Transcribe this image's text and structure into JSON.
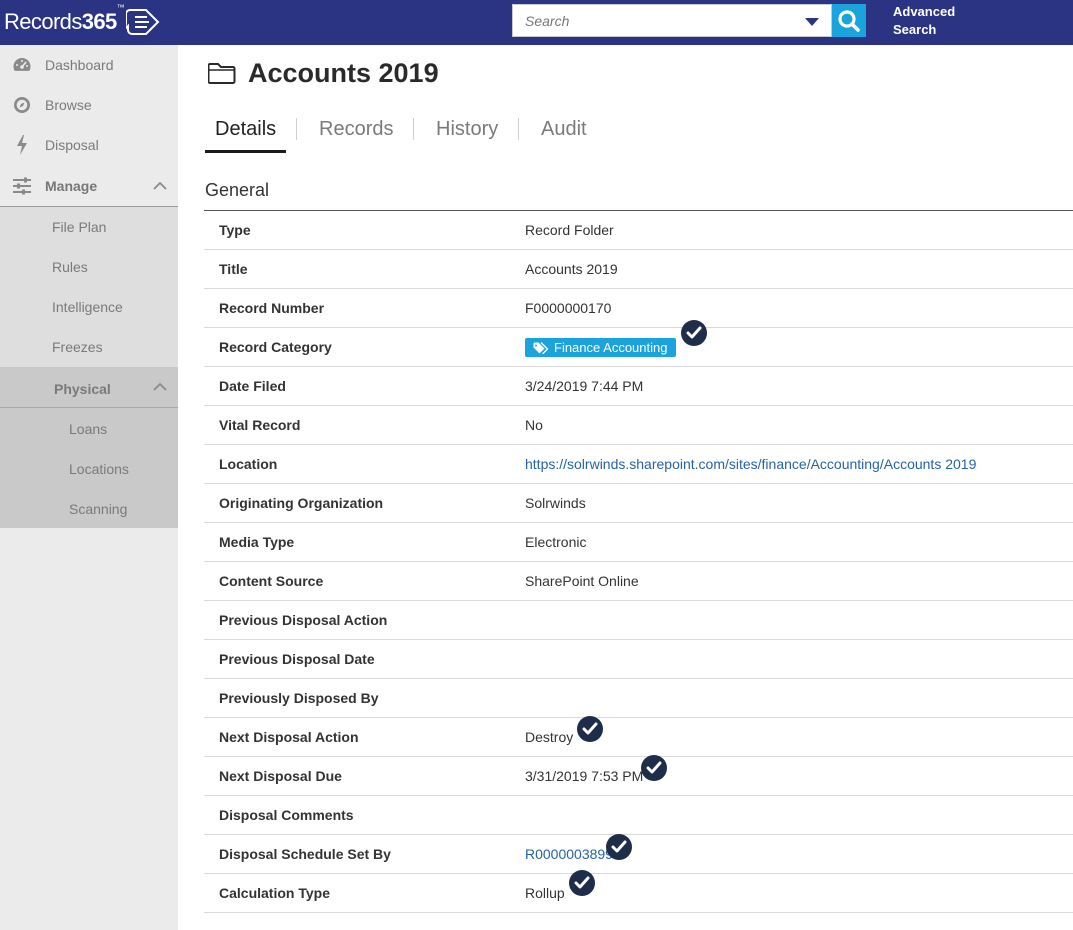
{
  "app": {
    "logo_text_light": "Records",
    "logo_text_bold": "365",
    "logo_tm": "™"
  },
  "search": {
    "placeholder": "Search",
    "advanced_line1": "Advanced",
    "advanced_line2": "Search"
  },
  "sidebar": {
    "items": [
      {
        "label": "Dashboard",
        "icon": "dashboard-gauge-icon"
      },
      {
        "label": "Browse",
        "icon": "compass-icon"
      },
      {
        "label": "Disposal",
        "icon": "lightning-bolt-icon"
      },
      {
        "label": "Manage",
        "icon": "sliders-icon"
      }
    ],
    "manage_items": [
      "File Plan",
      "Rules",
      "Intelligence",
      "Freezes"
    ],
    "physical_label": "Physical",
    "physical_items": [
      "Loans",
      "Locations",
      "Scanning"
    ]
  },
  "page": {
    "title": "Accounts 2019",
    "icon": "folder-icon"
  },
  "tabs": [
    "Details",
    "Records",
    "History",
    "Audit"
  ],
  "active_tab": "Details",
  "section": {
    "title": "General"
  },
  "fields": [
    {
      "key": "Type",
      "value": "Record Folder"
    },
    {
      "key": "Title",
      "value": "Accounts 2019"
    },
    {
      "key": "Record Number",
      "value": "F0000000170"
    },
    {
      "key": "Record Category",
      "value": "Finance Accounting",
      "tag": true,
      "verified": true
    },
    {
      "key": "Date Filed",
      "value": "3/24/2019 7:44 PM"
    },
    {
      "key": "Vital Record",
      "value": "No"
    },
    {
      "key": "Location",
      "value": "https://solrwinds.sharepoint.com/sites/finance/Accounting/Accounts 2019",
      "link": true
    },
    {
      "key": "Originating Organization",
      "value": "Solrwinds"
    },
    {
      "key": "Media Type",
      "value": "Electronic"
    },
    {
      "key": "Content Source",
      "value": "SharePoint Online"
    },
    {
      "key": "Previous Disposal Action",
      "value": ""
    },
    {
      "key": "Previous Disposal Date",
      "value": ""
    },
    {
      "key": "Previously Disposed By",
      "value": ""
    },
    {
      "key": "Next Disposal Action",
      "value": "Destroy",
      "verified": true
    },
    {
      "key": "Next Disposal Due",
      "value": "3/31/2019 7:53 PM",
      "verified": true
    },
    {
      "key": "Disposal Comments",
      "value": ""
    },
    {
      "key": "Disposal Schedule Set By",
      "value": "R0000003899",
      "link": true,
      "verified": true
    },
    {
      "key": "Calculation Type",
      "value": "Rollup",
      "verified": true
    }
  ],
  "colors": {
    "topbar": "#2b3383",
    "accent": "#1aa3dd",
    "link": "#2563a8",
    "check_badge": "#1d2d4a"
  }
}
